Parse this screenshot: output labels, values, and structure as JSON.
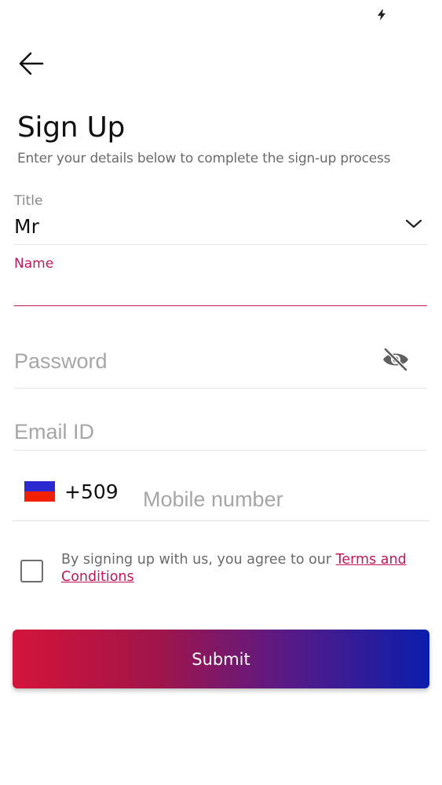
{
  "colors": {
    "accent": "#c2185b",
    "gradient_start": "#d4143a",
    "gradient_end": "#0a1eac",
    "flag_top": "#2a2ad0",
    "flag_bottom": "#f02000"
  },
  "status_bar": {
    "icon": "lightning-bolt-icon"
  },
  "header": {
    "back_icon": "arrow-left-icon",
    "title": "Sign Up",
    "subtitle": "Enter your details below to complete the sign-up process"
  },
  "form": {
    "title_field": {
      "label": "Title",
      "value": "Mr",
      "icon": "chevron-down-icon"
    },
    "name_field": {
      "label": "Name",
      "value": ""
    },
    "password_field": {
      "placeholder": "Password",
      "value": "",
      "icon": "eye-off-icon"
    },
    "email_field": {
      "placeholder": "Email ID",
      "value": ""
    },
    "phone_field": {
      "dial_code": "+509",
      "placeholder": "Mobile number",
      "value": ""
    }
  },
  "terms": {
    "prefix": "By signing up with us, you agree to our ",
    "link_text": "Terms and Conditions",
    "checked": false
  },
  "submit": {
    "label": "Submit"
  }
}
